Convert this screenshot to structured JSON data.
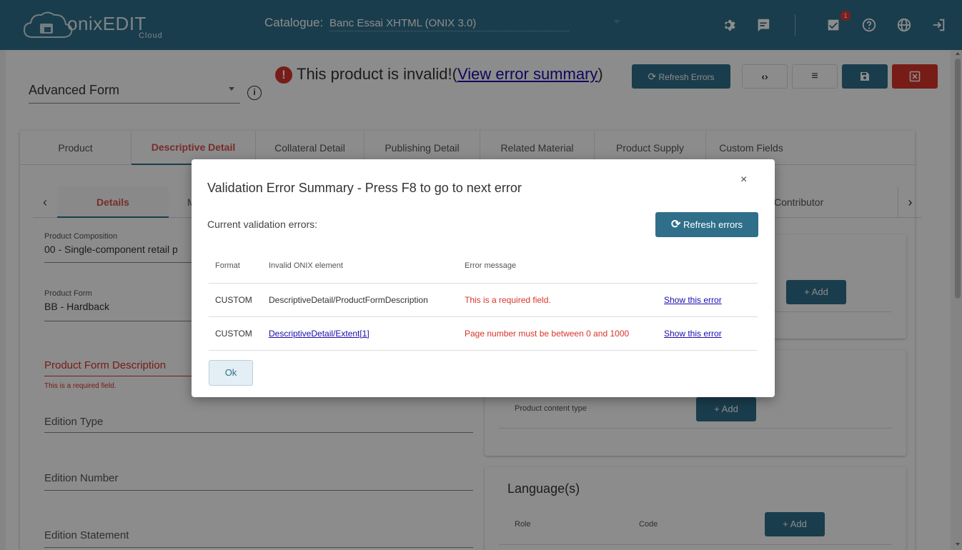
{
  "header": {
    "logo_text": "onixEDIT",
    "logo_sub": "Cloud",
    "catalogue_label": "Catalogue:",
    "catalogue_value": "Banc Essai XHTML (ONIX 3.0)",
    "notification_count": "1"
  },
  "toolbar": {
    "form_select": "Advanced Form",
    "invalid_text": "This product is invalid!(",
    "invalid_link": "View error summary",
    "invalid_close": ")",
    "refresh_errors": "Refresh Errors"
  },
  "tabs": [
    {
      "label": "Product"
    },
    {
      "label": "Descriptive Detail"
    },
    {
      "label": "Collateral Detail"
    },
    {
      "label": "Publishing Detail"
    },
    {
      "label": "Related Material"
    },
    {
      "label": "Product Supply"
    },
    {
      "label": "Custom Fields"
    }
  ],
  "subtabs": {
    "details": "Details",
    "m_partial": "M",
    "contributor": "Contributor"
  },
  "form": {
    "product_composition_label": "Product Composition",
    "product_composition_value": "00 - Single-component retail p",
    "product_form_label": "Product Form",
    "product_form_value": "BB - Hardback",
    "product_form_desc_label": "Product Form Description",
    "product_form_desc_error": "This is a required field.",
    "edition_type_label": "Edition Type",
    "edition_number_label": "Edition Number",
    "edition_statement_label": "Edition Statement"
  },
  "right_panel": {
    "add_label": "Add",
    "product_content_type": "Product content type",
    "languages_title": "Language(s)",
    "role_label": "Role",
    "code_label": "Code"
  },
  "modal": {
    "title": "Validation Error Summary - Press F8 to go to next error",
    "close": "×",
    "subtitle": "Current validation errors:",
    "refresh_label": "Refresh errors",
    "columns": [
      "Format",
      "Invalid ONIX element",
      "Error message",
      ""
    ],
    "rows": [
      {
        "format": "CUSTOM",
        "element": "DescriptiveDetail/ProductFormDescription",
        "message": "This is a required field.",
        "action": "Show this error"
      },
      {
        "format": "CUSTOM",
        "element": "DescriptiveDetail/Extent[1]",
        "message": "Page number must be between 0 and 1000",
        "action": "Show this error"
      }
    ],
    "ok_label": "Ok"
  }
}
